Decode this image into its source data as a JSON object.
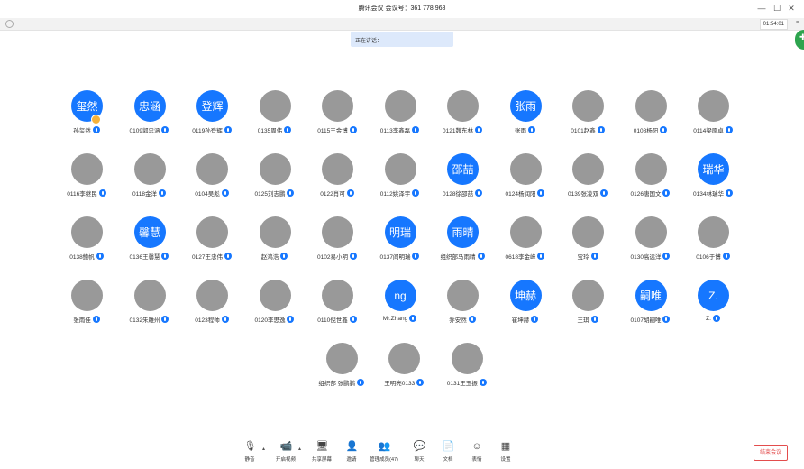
{
  "window": {
    "title": "腾讯会议  会议号：361 778 968",
    "controls": [
      "—",
      "☐",
      "✕"
    ]
  },
  "infobar": {
    "timer": "01:54:01",
    "menu": "≡"
  },
  "speaking_banner": {
    "text": "正在讲话："
  },
  "colors": {
    "accent": "#1677ff",
    "end_button": "#e34d4d",
    "side_widget": "#2da44e",
    "avatar_photo": "#999999"
  },
  "participants": [
    {
      "name": "孙玺然",
      "avatar_text": "玺然",
      "avatar_type": "text",
      "host": true
    },
    {
      "name": "0109郭忠涵",
      "avatar_text": "忠涵",
      "avatar_type": "text"
    },
    {
      "name": "0119孙登辉",
      "avatar_text": "登辉",
      "avatar_type": "text"
    },
    {
      "name": "0135周伟",
      "avatar_type": "photo"
    },
    {
      "name": "0115王金博",
      "avatar_type": "photo"
    },
    {
      "name": "0113李鑫磊",
      "avatar_type": "photo"
    },
    {
      "name": "0121魏东林",
      "avatar_type": "photo"
    },
    {
      "name": "张雨",
      "avatar_text": "张雨",
      "avatar_type": "text"
    },
    {
      "name": "0101赵鑫",
      "avatar_type": "photo"
    },
    {
      "name": "0108杨阳",
      "avatar_type": "photo"
    },
    {
      "name": "0114梁原卓",
      "avatar_type": "photo"
    },
    {
      "name": "0116李继民",
      "avatar_type": "photo"
    },
    {
      "name": "0118金洋",
      "avatar_type": "photo"
    },
    {
      "name": "0104吴彪",
      "avatar_type": "photo"
    },
    {
      "name": "0125刘志鹏",
      "avatar_type": "photo"
    },
    {
      "name": "0122肖可",
      "avatar_type": "photo"
    },
    {
      "name": "0112姚泽宇",
      "avatar_type": "photo"
    },
    {
      "name": "0128徐邵喆",
      "avatar_text": "邵喆",
      "avatar_type": "text"
    },
    {
      "name": "0124杨润阳",
      "avatar_type": "photo"
    },
    {
      "name": "0139张凌双",
      "avatar_type": "photo"
    },
    {
      "name": "0126唐国文",
      "avatar_type": "photo"
    },
    {
      "name": "0134林瑞华",
      "avatar_text": "瑞华",
      "avatar_type": "text"
    },
    {
      "name": "0138鲍帆",
      "avatar_type": "photo"
    },
    {
      "name": "0136王馨慧",
      "avatar_text": "馨慧",
      "avatar_type": "text"
    },
    {
      "name": "0127王忠伟",
      "avatar_type": "photo"
    },
    {
      "name": "赵鸿浩",
      "avatar_type": "photo"
    },
    {
      "name": "0102易小明",
      "avatar_type": "photo"
    },
    {
      "name": "0137阎明瑞",
      "avatar_text": "明瑞",
      "avatar_type": "text"
    },
    {
      "name": "组织部马雨晴",
      "avatar_text": "雨晴",
      "avatar_type": "text"
    },
    {
      "name": "0618李金峰",
      "avatar_type": "photo"
    },
    {
      "name": "宝玲",
      "avatar_type": "photo"
    },
    {
      "name": "0130高远洋",
      "avatar_type": "photo"
    },
    {
      "name": "0106于博",
      "avatar_type": "photo"
    },
    {
      "name": "张雨佳",
      "avatar_type": "photo"
    },
    {
      "name": "0132朱雕州",
      "avatar_type": "photo"
    },
    {
      "name": "0123程帅",
      "avatar_type": "photo"
    },
    {
      "name": "0120李思逸",
      "avatar_type": "photo"
    },
    {
      "name": "0110倪世鑫",
      "avatar_type": "photo"
    },
    {
      "name": "Mr.Zhang",
      "avatar_text": "ng",
      "avatar_type": "text"
    },
    {
      "name": "乔安然",
      "avatar_type": "photo"
    },
    {
      "name": "崔坤赫",
      "avatar_text": "坤赫",
      "avatar_type": "text"
    },
    {
      "name": "王琪",
      "avatar_type": "photo"
    },
    {
      "name": "0107胡嗣唯",
      "avatar_text": "嗣唯",
      "avatar_type": "text"
    },
    {
      "name": "Z.",
      "avatar_text": "Z.",
      "avatar_type": "text"
    },
    {
      "name": "组织部 张鹏鹏",
      "avatar_type": "photo"
    },
    {
      "name": "王明亮0133",
      "avatar_type": "photo"
    },
    {
      "name": "0131王玉振",
      "avatar_type": "photo"
    }
  ],
  "toolbar": {
    "items": [
      {
        "label": "静音",
        "icon": "microphone-icon",
        "glyph": "🎙"
      },
      {
        "label": "开启视频",
        "icon": "camera-off-icon",
        "glyph": "📹"
      },
      {
        "label": "共享屏幕",
        "icon": "share-screen-icon",
        "glyph": "🖥"
      },
      {
        "label": "邀请",
        "icon": "invite-icon",
        "glyph": "👤"
      },
      {
        "label": "管理成员(47)",
        "icon": "members-icon",
        "glyph": "👥"
      },
      {
        "label": "聊天",
        "icon": "chat-icon",
        "glyph": "💬"
      },
      {
        "label": "文档",
        "icon": "document-icon",
        "glyph": "📄"
      },
      {
        "label": "表情",
        "icon": "emoji-icon",
        "glyph": "☺"
      },
      {
        "label": "设置",
        "icon": "settings-grid-icon",
        "glyph": "▦"
      }
    ],
    "caret": "▴",
    "end_button": "结束会议"
  }
}
